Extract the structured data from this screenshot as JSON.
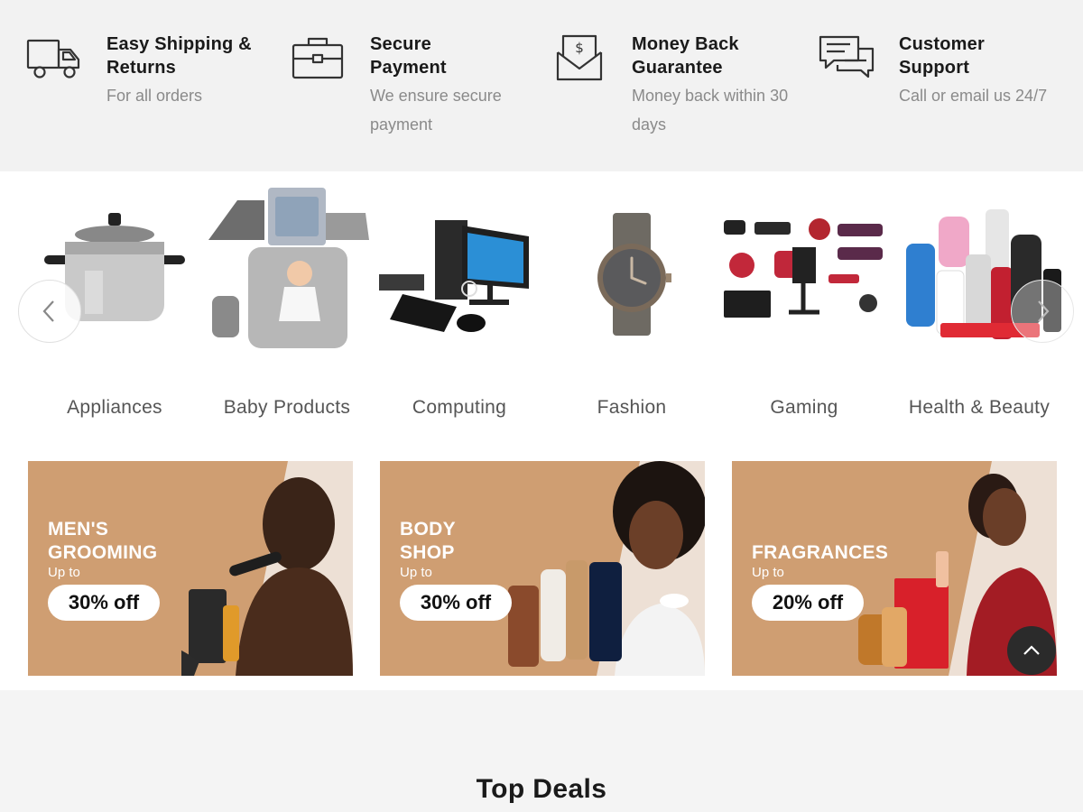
{
  "features": [
    {
      "icon": "truck-icon",
      "title": "Easy Shipping & Returns",
      "subtitle": "For all orders"
    },
    {
      "icon": "briefcase-icon",
      "title": "Secure Payment",
      "subtitle": "We ensure secure payment"
    },
    {
      "icon": "money-envelope-icon",
      "title": "Money Back Guarantee",
      "subtitle": "Money back within 30 days"
    },
    {
      "icon": "chat-bubbles-icon",
      "title": "Customer Support",
      "subtitle": "Call or email us 24/7"
    }
  ],
  "categories": [
    {
      "label": "Appliances",
      "image": "pressure-cooker"
    },
    {
      "label": "Baby Products",
      "image": "baby-changing-mat"
    },
    {
      "label": "Computing",
      "image": "desktop-computer"
    },
    {
      "label": "Fashion",
      "image": "wristwatch"
    },
    {
      "label": "Gaming",
      "image": "gaming-accessories"
    },
    {
      "label": "Health & Beauty",
      "image": "beauty-products"
    }
  ],
  "carousel": {
    "prev_icon": "chevron-left-icon",
    "next_icon": "chevron-right-icon"
  },
  "banners": [
    {
      "title_line1": "MEN'S",
      "title_line2": "GROOMING",
      "upto": "Up to",
      "discount": "30% off"
    },
    {
      "title_line1": "BODY",
      "title_line2": "SHOP",
      "upto": "Up to",
      "discount": "30% off"
    },
    {
      "title_line1": "",
      "title_line2": "FRAGRANCES",
      "upto": "Up to",
      "discount": "20% off"
    }
  ],
  "back_to_top_icon": "chevron-up-icon",
  "top_deals": {
    "heading": "Top Deals"
  },
  "colors": {
    "banner_bg": "#cf9e72",
    "page_bg": "#f4f4f4",
    "features_bg": "#f2f2f2"
  }
}
